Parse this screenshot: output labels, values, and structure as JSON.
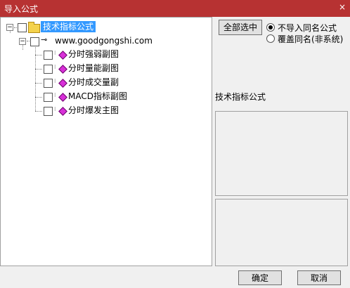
{
  "window": {
    "title": "导入公式",
    "close_glyph": "×"
  },
  "tree": {
    "root": {
      "label": "技术指标公式"
    },
    "site": {
      "label": "www.goodgongshi.com"
    },
    "items": [
      {
        "label": "分时强弱副图"
      },
      {
        "label": "分时量能副图"
      },
      {
        "label": "分时成交量副"
      },
      {
        "label": "MACD指标副图"
      },
      {
        "label": "分时爆发主图"
      }
    ]
  },
  "buttons": {
    "select_all": "全部选中",
    "ok": "确定",
    "cancel": "取消"
  },
  "options": [
    {
      "label": "不导入同名公式",
      "checked": true
    },
    {
      "label": "覆盖同名(非系统)",
      "checked": false
    }
  ],
  "info": {
    "formula_label": "技术指标公式"
  },
  "icons": {
    "folder": "folder-icon",
    "key": "key-icon",
    "formula": "formula-diamond-icon",
    "expander": "minus-expander-icon",
    "close": "close-icon"
  },
  "colors": {
    "titlebar": "#b73232",
    "selection": "#3399ff",
    "folder": "#f4d24c",
    "formula_icon": "#d830d8"
  }
}
